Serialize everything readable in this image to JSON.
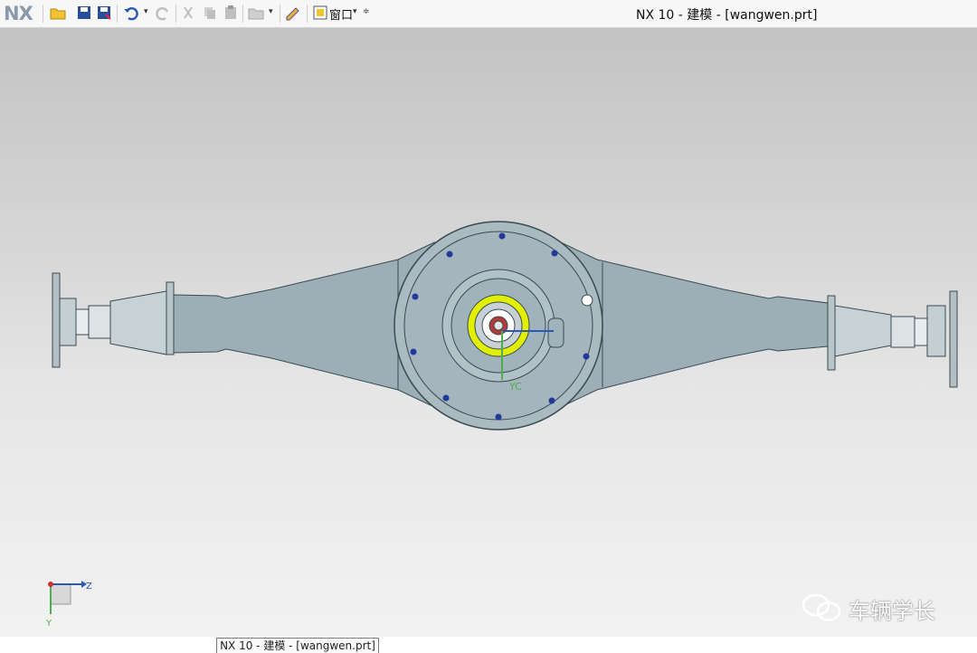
{
  "app": {
    "logo": "NX",
    "window_title": "NX 10 - 建模 - [wangwen.prt]"
  },
  "toolbar": {
    "buttons": [
      {
        "id": "open",
        "icon": "open-folder-icon"
      },
      {
        "id": "save",
        "icon": "save-icon"
      },
      {
        "id": "save_as",
        "icon": "save-as-icon"
      },
      {
        "id": "undo",
        "icon": "undo-icon"
      },
      {
        "id": "redo",
        "icon": "redo-icon"
      },
      {
        "id": "cut",
        "icon": "cut-icon"
      },
      {
        "id": "copy",
        "icon": "copy-icon"
      },
      {
        "id": "paste",
        "icon": "paste-icon"
      },
      {
        "id": "open_recent",
        "icon": "folder-icon"
      },
      {
        "id": "repeat",
        "icon": "pencil-icon"
      }
    ],
    "window_menu_label": "窗口"
  },
  "viewport": {
    "triad": {
      "z_label": "Z",
      "y_label": "Y"
    },
    "model_label": "YC"
  },
  "taskbar": {
    "item_label": "NX 10 - 建模 - [wangwen.prt]"
  },
  "watermark": {
    "text": "车辆学长"
  },
  "colors": {
    "body": "#9cafb7",
    "hub": "#d8dde0",
    "edge": "#3a4a52",
    "bolt": "#1f3a9a",
    "yellow": "#e2f000"
  }
}
